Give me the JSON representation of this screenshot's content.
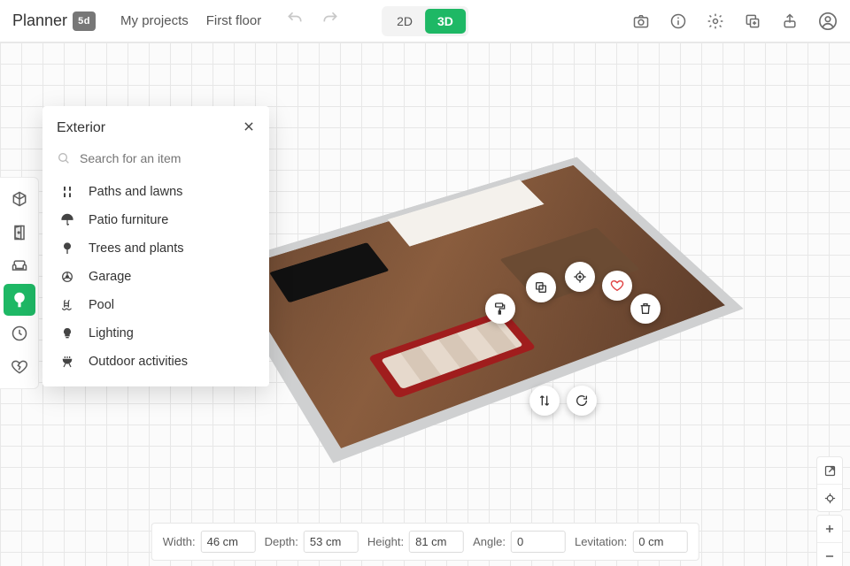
{
  "brand": {
    "name": "Planner",
    "badge": "5d"
  },
  "menu": {
    "my_projects": "My projects",
    "floor": "First floor"
  },
  "view": {
    "mode_2d": "2D",
    "mode_3d": "3D",
    "active": "3D"
  },
  "panel": {
    "title": "Exterior",
    "search_placeholder": "Search for an item",
    "items": [
      {
        "label": "Paths and lawns"
      },
      {
        "label": "Patio furniture"
      },
      {
        "label": "Trees and plants"
      },
      {
        "label": "Garage"
      },
      {
        "label": "Pool"
      },
      {
        "label": "Lighting"
      },
      {
        "label": "Outdoor activities"
      }
    ]
  },
  "measure": {
    "width_label": "Width:",
    "width_value": "46 cm",
    "depth_label": "Depth:",
    "depth_value": "53 cm",
    "height_label": "Height:",
    "height_value": "81 cm",
    "angle_label": "Angle:",
    "angle_value": "0",
    "lev_label": "Levitation:",
    "lev_value": "0 cm"
  }
}
